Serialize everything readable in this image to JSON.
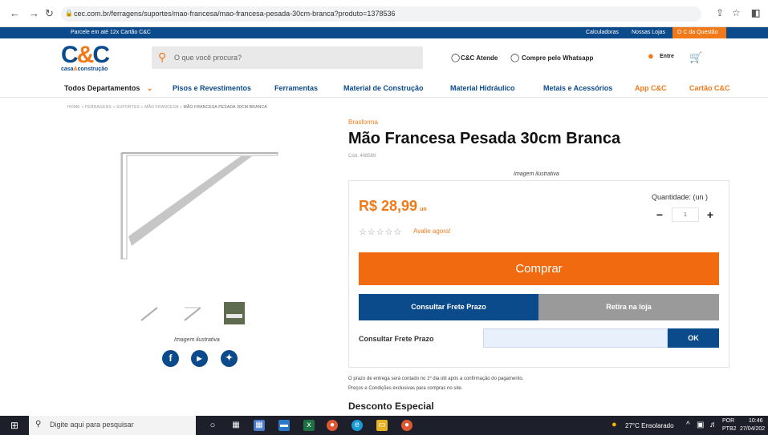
{
  "browser": {
    "url": "cec.com.br/ferragens/suportes/mao-francesa/mao-francesa-pesada-30cm-branca?produto=1378536"
  },
  "topbar": {
    "promo": "Parcele em até 12x Cartão C&C",
    "links": [
      "Calculadoras",
      "Nossas Lojas"
    ],
    "highlight": "O C da Questão"
  },
  "header": {
    "logo_cc": "C&C",
    "logo_sub_a": "casa",
    "logo_sub_amp": "&",
    "logo_sub_b": "construção",
    "search_placeholder": "O que você procura?",
    "atende": "C&C Atende",
    "whatsapp": "Compre pelo Whatsapp",
    "login": "Entre"
  },
  "nav": {
    "departments": "Todos Departamentos",
    "items": [
      "Pisos e Revestimentos",
      "Ferramentas",
      "Material de Construção",
      "Material Hidráulico",
      "Metais e Acessórios",
      "App C&C",
      "Cartão C&C"
    ]
  },
  "breadcrumb": {
    "path": "HOME  »  FERRAGENS  »  SUPORTES  »  MÃO FRANCESA  »",
    "current": "MÃO FRANCESA PESADA 30CM BRANCA"
  },
  "gallery": {
    "caption_top": "Imagem ilustrativa",
    "caption_bottom": "Imagem ilustrativa",
    "social": [
      "facebook-icon",
      "youtube-icon",
      "twitter-icon"
    ]
  },
  "product": {
    "brand": "Brasforma",
    "title": "Mão Francesa Pesada 30cm Branca",
    "code": "Cód. 408589",
    "price": "R$ 28,99",
    "unit": "un",
    "rate_link": "Avalie agora!",
    "quantity_label": "Quantidade: (un )",
    "quantity": "1",
    "buy_label": "Comprar",
    "tab_frete": "Consultar Frete Prazo",
    "tab_retira": "Retira na loja",
    "frete_label": "Consultar Frete Prazo",
    "ok_label": "OK",
    "note1": "O prazo de entrega será contado no 1º dia útil após a confirmação do pagamento.",
    "note2": "Preços e Condições exclusivas para compras no site.",
    "desc_heading": "Desconto Especial"
  },
  "taskbar": {
    "search_placeholder": "Digite aqui para pesquisar",
    "weather": "27°C  Ensolarado",
    "lang1": "POR",
    "lang2": "PTB2",
    "time": "10:46",
    "date": "27/04/202"
  },
  "colors": {
    "brand_blue": "#0b4a8b",
    "brand_orange": "#f07a1a",
    "buy_orange": "#f26a10"
  }
}
